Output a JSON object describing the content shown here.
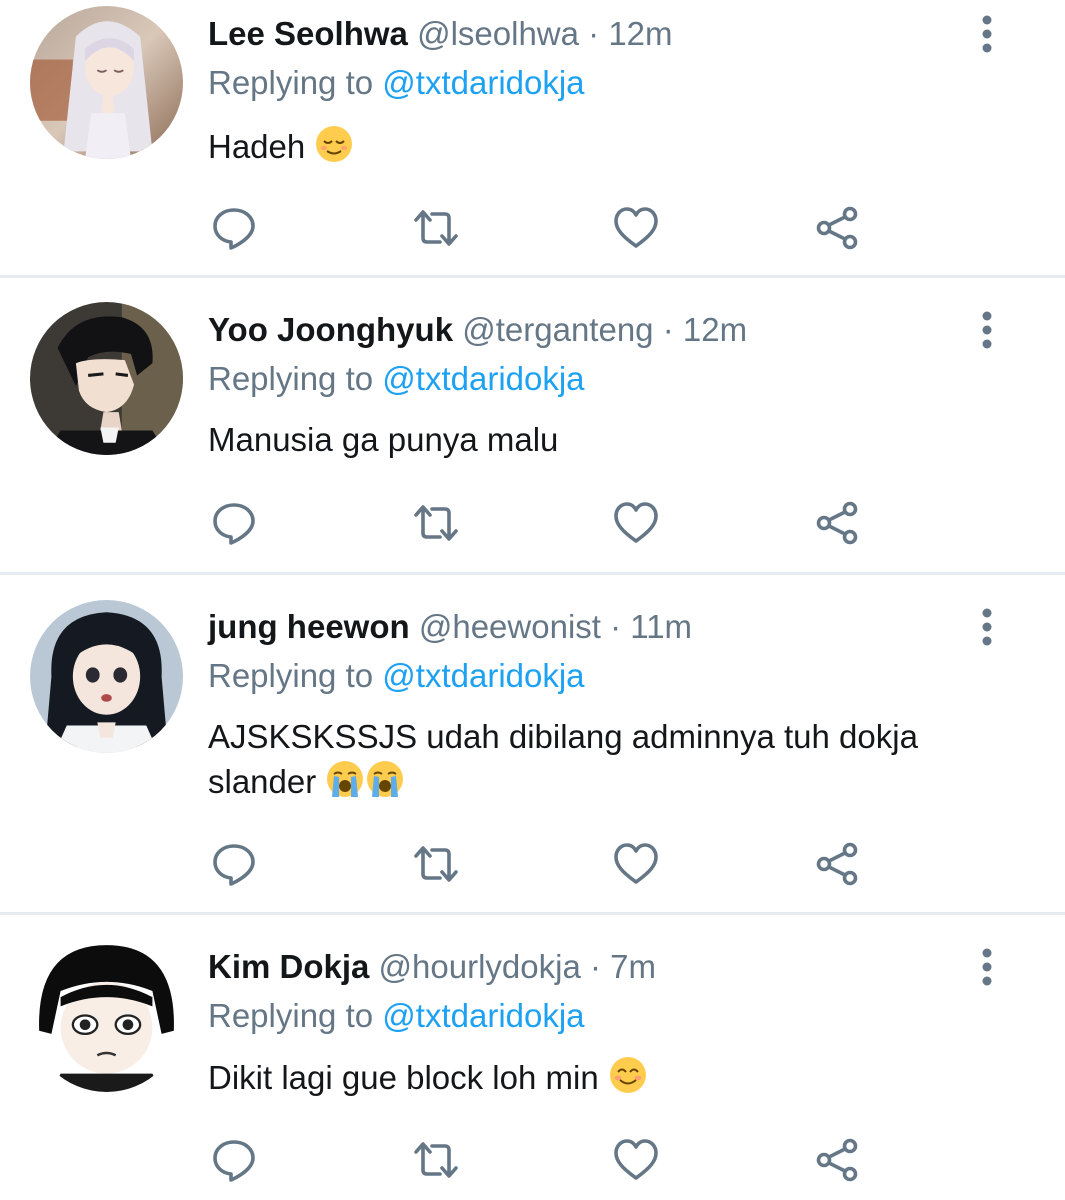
{
  "tweets": [
    {
      "name": "Lee Seolhwa",
      "handle": "@lseolhwa",
      "separator": "·",
      "time": "12m",
      "replying_prefix": "Replying to",
      "replying_to": "@txtdaridokja",
      "text": "Hadeh",
      "emojis": [
        "relieved-face-emoji"
      ],
      "avatar": "avatar-white-haired-praying-girl"
    },
    {
      "name": "Yoo Joonghyuk",
      "handle": "@terganteng",
      "separator": "·",
      "time": "12m",
      "replying_prefix": "Replying to",
      "replying_to": "@txtdaridokja",
      "text": "Manusia ga punya malu",
      "emojis": [],
      "avatar": "avatar-black-haired-man-profile"
    },
    {
      "name": "jung heewon",
      "handle": "@heewonist",
      "separator": "·",
      "time": "11m",
      "replying_prefix": "Replying to",
      "replying_to": "@txtdaridokja",
      "text": "AJSKSKSSJS udah dibilang adminnya tuh dokja slander",
      "emojis": [
        "loudly-crying-face-emoji",
        "loudly-crying-face-emoji"
      ],
      "avatar": "avatar-dark-haired-woman-surprised"
    },
    {
      "name": "Kim Dokja",
      "handle": "@hourlydokja",
      "separator": "·",
      "time": "7m",
      "replying_prefix": "Replying to",
      "replying_to": "@txtdaridokja",
      "text": "Dikit lagi gue block loh min",
      "emojis": [
        "smiling-face-emoji"
      ],
      "avatar": "avatar-black-haired-boy-front"
    }
  ],
  "actions": [
    "reply-icon",
    "retweet-icon",
    "like-icon",
    "share-icon"
  ],
  "colors": {
    "accent": "#1da1f2",
    "secondary_text": "#657786",
    "icon": "#657786",
    "divider": "#e6ecf0"
  }
}
